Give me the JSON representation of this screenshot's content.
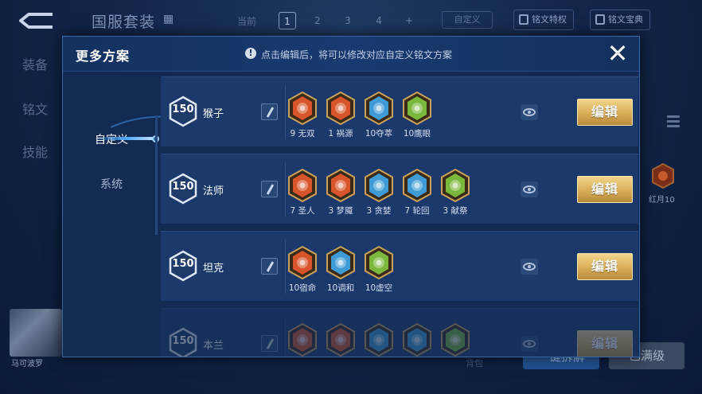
{
  "background": {
    "title": "国服套装",
    "current_label": "当前",
    "pages": [
      "1",
      "2",
      "3",
      "4",
      "+"
    ],
    "custom_label": "自定义",
    "privilege_label": "铭文特权",
    "treasure_label": "铭文宝典",
    "side_items": [
      "装备",
      "铭文",
      "技能"
    ],
    "hero_name": "马可波罗",
    "bottom_label": "背包",
    "button_one": "一键拆解",
    "button_two": "已满级",
    "rune_label": "红月10"
  },
  "modal": {
    "title": "更多方案",
    "info_icon": "!",
    "info_text": "点击编辑后，将可以修改对应自定义铭文方案",
    "close_icon": "✕",
    "tabs": [
      "自定义",
      "系统"
    ],
    "edit_label": "编辑",
    "rows": [
      {
        "level": "150",
        "name": "猴子",
        "runes": [
          {
            "label": "9 无双",
            "color": "#d8542a"
          },
          {
            "label": "1 祸源",
            "color": "#d8542a"
          },
          {
            "label": "10夺萃",
            "color": "#3e9bd6"
          },
          {
            "label": "10鹰眼",
            "color": "#7ab73a"
          }
        ]
      },
      {
        "level": "150",
        "name": "法师",
        "runes": [
          {
            "label": "7 圣人",
            "color": "#d8542a"
          },
          {
            "label": "3 梦魇",
            "color": "#d8542a"
          },
          {
            "label": "3 贪婪",
            "color": "#3e9bd6"
          },
          {
            "label": "7 轮回",
            "color": "#3e9bd6"
          },
          {
            "label": "3 献祭",
            "color": "#7ab73a"
          }
        ]
      },
      {
        "level": "150",
        "name": "坦克",
        "runes": [
          {
            "label": "10宿命",
            "color": "#d8542a"
          },
          {
            "label": "10调和",
            "color": "#3e9bd6"
          },
          {
            "label": "10虚空",
            "color": "#7ab73a"
          }
        ]
      },
      {
        "level": "150",
        "name": "本兰",
        "runes": [
          {
            "label": "",
            "color": "#d8542a"
          },
          {
            "label": "",
            "color": "#d8542a"
          },
          {
            "label": "",
            "color": "#3e9bd6"
          },
          {
            "label": "",
            "color": "#3e9bd6"
          },
          {
            "label": "",
            "color": "#7ab73a"
          }
        ]
      }
    ]
  }
}
